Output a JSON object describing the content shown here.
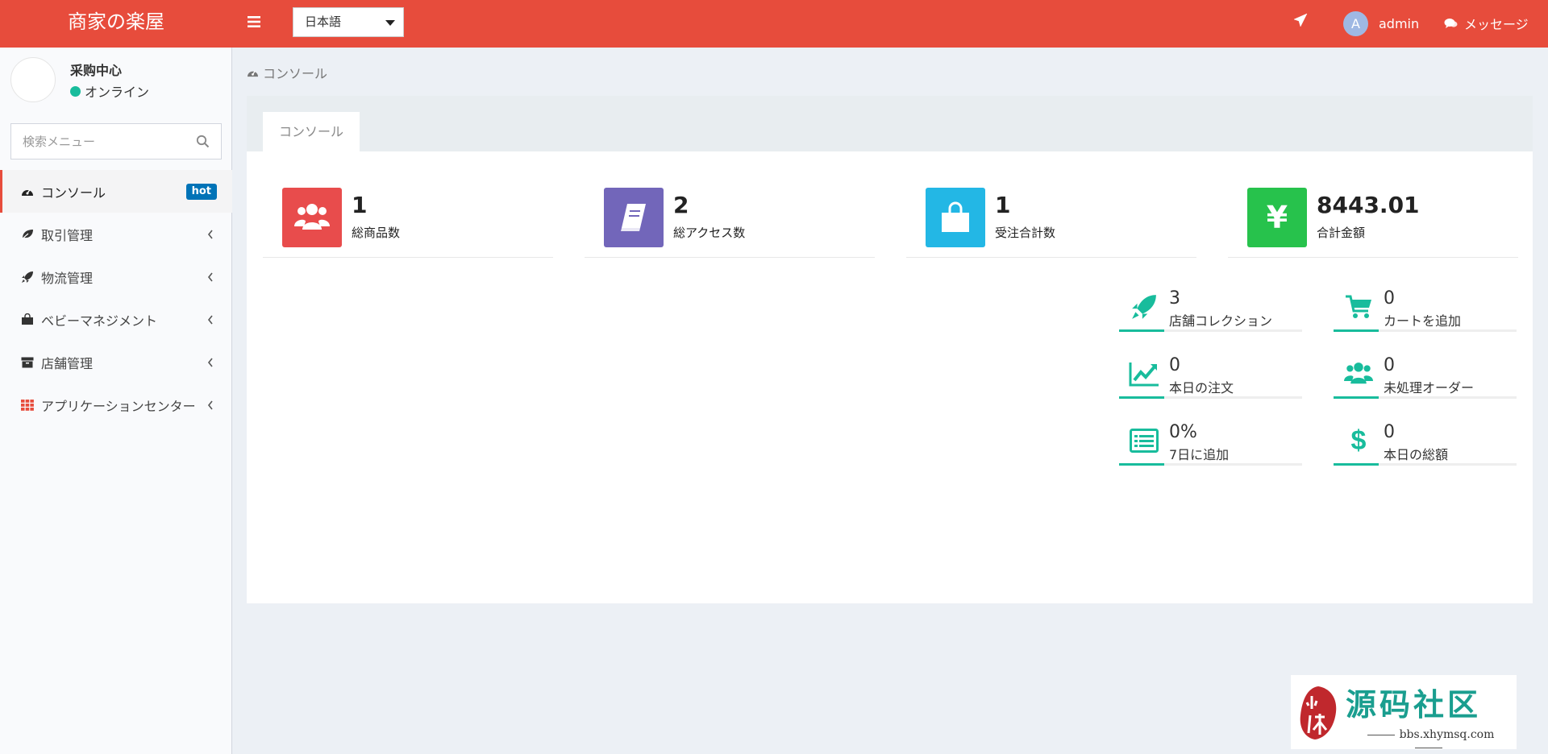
{
  "header": {
    "logo": "商家の楽屋",
    "language": "日本語",
    "user_initial": "A",
    "user_name": "admin",
    "messages_label": "メッセージ"
  },
  "sidebar": {
    "user_name": "采购中心",
    "status": "オンライン",
    "search_placeholder": "検索メニュー",
    "items": [
      {
        "label": "コンソール",
        "icon": "dashboard-icon",
        "badge": "hot",
        "active": true
      },
      {
        "label": "取引管理",
        "icon": "leaf-icon"
      },
      {
        "label": "物流管理",
        "icon": "rocket-icon"
      },
      {
        "label": "ベビーマネジメント",
        "icon": "shopping-bag-icon"
      },
      {
        "label": "店舗管理",
        "icon": "archive-icon"
      },
      {
        "label": "アプリケーションセンター",
        "icon": "grid-icon"
      }
    ]
  },
  "breadcrumb": "コンソール",
  "tab": "コンソール",
  "stats": [
    {
      "value": "1",
      "label": "総商品数",
      "icon": "users-icon",
      "color": "#e84c4c"
    },
    {
      "value": "2",
      "label": "総アクセス数",
      "icon": "book-icon",
      "color": "#7266ba"
    },
    {
      "value": "1",
      "label": "受注合計数",
      "icon": "shopping-bag-icon",
      "color": "#23b7e5"
    },
    {
      "value": "8443.01",
      "label": "合計金額",
      "icon": "yen-icon",
      "color": "#27c24c"
    }
  ],
  "mini_stats": [
    {
      "value": "3",
      "label": "店舗コレクション",
      "icon": "rocket-icon"
    },
    {
      "value": "0",
      "label": "カートを追加",
      "icon": "cart-icon"
    },
    {
      "value": "0",
      "label": "本日の注文",
      "icon": "line-chart-icon"
    },
    {
      "value": "0",
      "label": "未処理オーダー",
      "icon": "users-icon"
    },
    {
      "value": "0%",
      "label": "7日に追加",
      "icon": "list-icon"
    },
    {
      "value": "0",
      "label": "本日の総額",
      "icon": "dollar-icon"
    }
  ],
  "watermark": {
    "seal": "小休",
    "title": "源码社区",
    "url": "bbs.xhymsq.com"
  },
  "colors": {
    "header": "#e74c3c",
    "accent": "#18bc9c",
    "badge": "#0073b7"
  }
}
